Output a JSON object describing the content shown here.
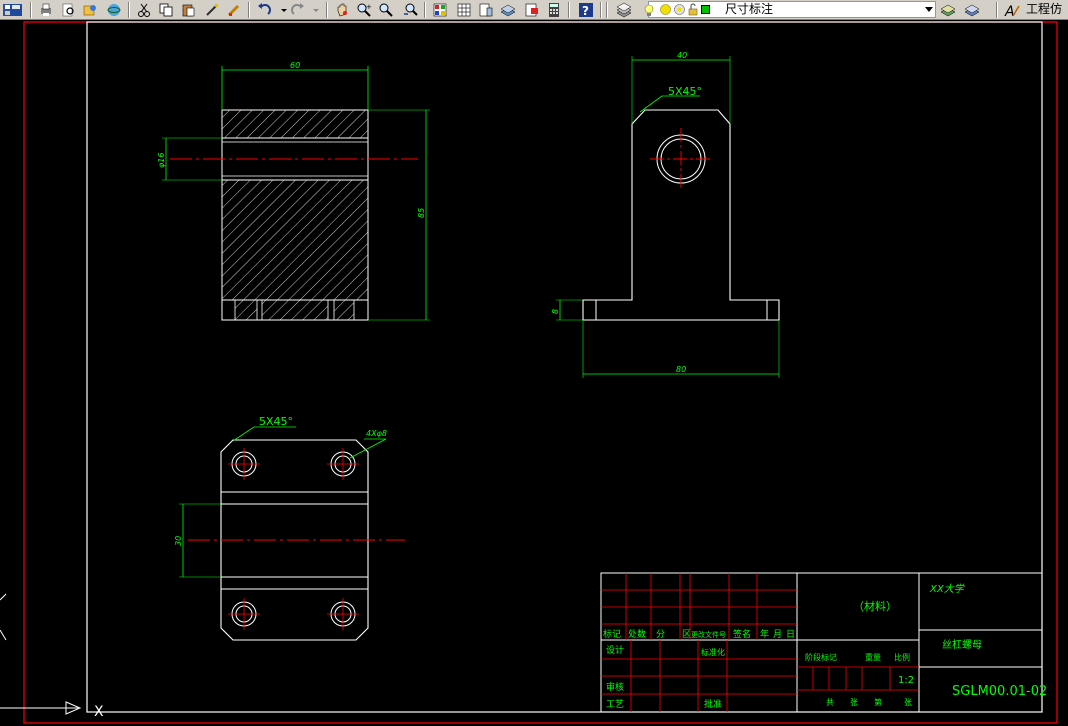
{
  "toolbar": {
    "icons": [
      "save-icon",
      "print-icon",
      "print-preview-icon",
      "publish-icon",
      "3d-orbit-icon",
      "cut-icon",
      "copy-icon",
      "paste-icon",
      "brush-icon",
      "match-properties-icon",
      "undo-icon",
      "redo-icon",
      "pan-icon",
      "zoom-realtime-icon",
      "zoom-window-icon",
      "zoom-previous-icon",
      "properties-icon",
      "design-center-icon",
      "tool-palettes-icon",
      "sheet-set-icon",
      "markup-icon",
      "calculator-icon",
      "help-icon",
      "layer-manager-icon",
      "layer-state-icon",
      "layer-current-icon",
      "layer-previous-icon"
    ],
    "layer_name": "尺寸标注",
    "style_name": "工程仿"
  },
  "colors": {
    "line_white": "#ffffff",
    "dim_green": "#00ff00",
    "center_red": "#ff0000",
    "frame_red": "#ff0000"
  },
  "drawing": {
    "front_view": {
      "width_dim": "60",
      "diameter_dim": "φ16",
      "height_dim": "85"
    },
    "side_view": {
      "chamfer": "5X45°",
      "top_width_dim": "40",
      "base_height_dim": "8",
      "base_width_dim": "80"
    },
    "top_view": {
      "chamfer": "5X45°",
      "hole_callout": "4Xφ8",
      "slot_dim": "30"
    },
    "title_block": {
      "material": "（材料）",
      "school": "XX大学",
      "part_name": "丝杠螺母",
      "drawing_no": "SGLM00.01-02",
      "scale": "1:2",
      "rev_headers": [
        "标记",
        "处数",
        "分",
        "区",
        "更改文件号",
        "签名",
        "年",
        "月",
        "日"
      ],
      "row_design": "设计",
      "row_std": "标准化",
      "row_review": "审核",
      "row_process": "工艺",
      "row_approve": "批准",
      "stage_header": "阶段标记",
      "weight_header": "重量",
      "ratio_header": "比例",
      "sheets_total": "共",
      "sheet_label": "张",
      "sheet_no": "第",
      "sheet_label2": "张"
    }
  }
}
